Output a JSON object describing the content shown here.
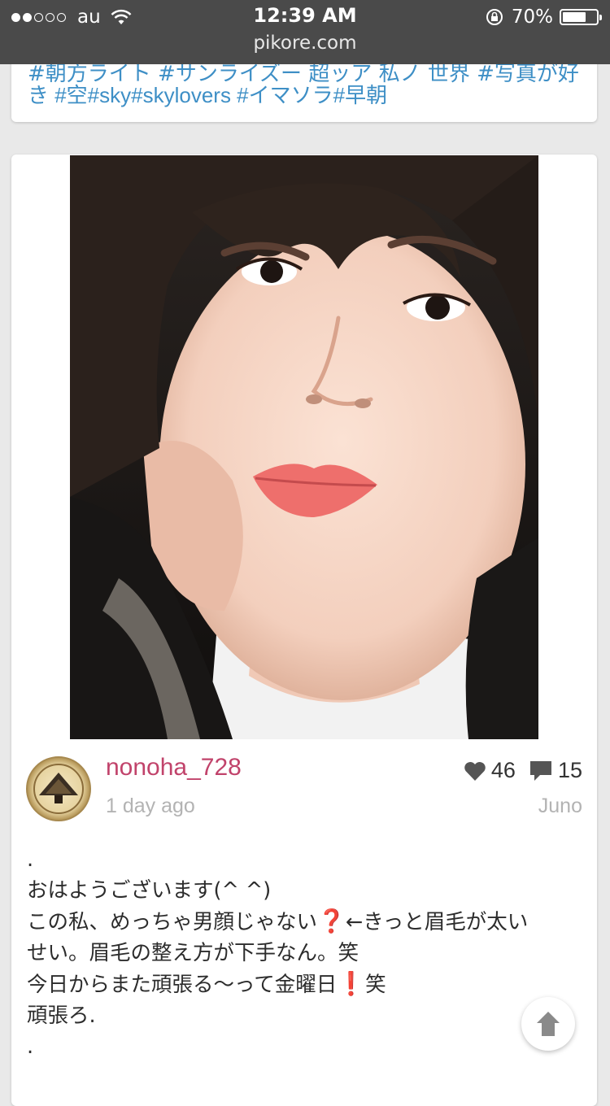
{
  "status_bar": {
    "signal_bars_filled": 2,
    "signal_bars_total": 5,
    "carrier": "au",
    "time": "12:39 AM",
    "battery_percent": "70%",
    "battery_level": 0.7,
    "url": "pikore.com",
    "icons": [
      "wifi-icon",
      "lock-rotation-icon",
      "battery-icon"
    ]
  },
  "previous_post": {
    "tags_line_partial": "#朝方ライト #サンライズー 超ッア 私ノ 世界 #写真が好",
    "tags_line": "き #空#sky#skylovers #イマソラ#早朝"
  },
  "post": {
    "photo_alt": "selfie photo",
    "username": "nonoha_728",
    "time_ago": "1 day ago",
    "likes": "46",
    "comments": "15",
    "filter": "Juno",
    "caption": {
      "line1": ".",
      "line2": "おはようございます(^ ^)",
      "line3a": "この私、めっちゃ男顔じゃない",
      "line3_emoji": "❓",
      "line3b": "←きっと眉毛が太い",
      "line4": "せい。眉毛の整え方が下手なん。笑",
      "line5a": "今日からまた頑張る〜って金曜日",
      "line5_emoji": "❗",
      "line5b": "笑",
      "line6": "頑張ろ.",
      "line7": "."
    },
    "colors": {
      "username": "#c1436b",
      "tags": "#3e8fc6",
      "muted": "#b3b3b3"
    }
  },
  "scroll_top_button": {
    "icon": "arrow-up-icon"
  }
}
